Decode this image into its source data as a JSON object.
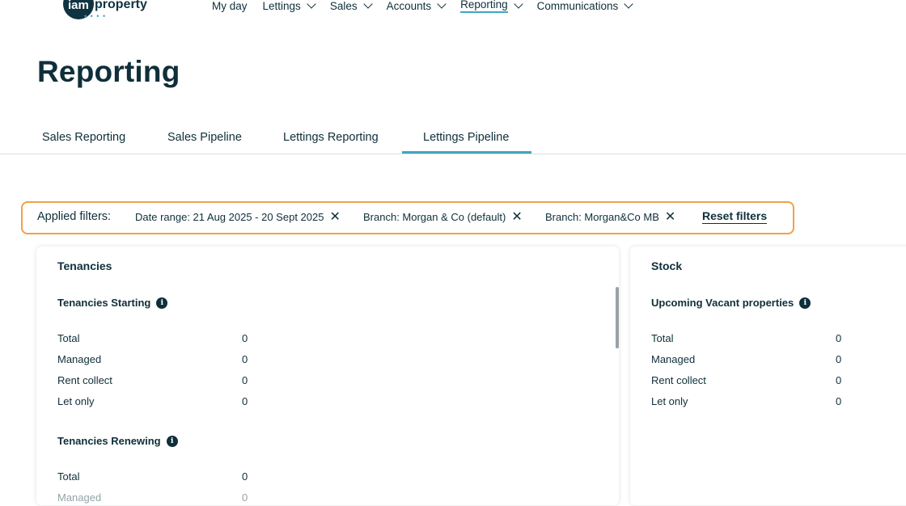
{
  "logo": {
    "iam": "iam",
    "property": "property",
    "dots": "• • • •"
  },
  "nav": [
    {
      "label": "My day",
      "has_dropdown": false,
      "active": false
    },
    {
      "label": "Lettings",
      "has_dropdown": true,
      "active": false
    },
    {
      "label": "Sales",
      "has_dropdown": true,
      "active": false
    },
    {
      "label": "Accounts",
      "has_dropdown": true,
      "active": false
    },
    {
      "label": "Reporting",
      "has_dropdown": true,
      "active": true
    },
    {
      "label": "Communications",
      "has_dropdown": true,
      "active": false
    }
  ],
  "page_title": "Reporting",
  "tabs": [
    {
      "label": "Sales Reporting",
      "active": false
    },
    {
      "label": "Sales Pipeline",
      "active": false
    },
    {
      "label": "Lettings Reporting",
      "active": false
    },
    {
      "label": "Lettings Pipeline",
      "active": true
    }
  ],
  "filters": {
    "label": "Applied filters:",
    "chips": [
      {
        "text": "Date range: 21 Aug 2025 - 20 Sept 2025",
        "remove_icon": "close-icon"
      },
      {
        "text": "Branch: Morgan & Co (default)",
        "remove_icon": "close-icon"
      },
      {
        "text": "Branch: Morgan&Co MB",
        "remove_icon": "close-icon"
      }
    ],
    "reset_label": "Reset filters",
    "highlight_color": "#f0a04b"
  },
  "tenancies": {
    "title": "Tenancies",
    "starting": {
      "title": "Tenancies Starting",
      "rows": [
        {
          "label": "Total",
          "value": "0"
        },
        {
          "label": "Managed",
          "value": "0"
        },
        {
          "label": "Rent collect",
          "value": "0"
        },
        {
          "label": "Let only",
          "value": "0"
        }
      ]
    },
    "renewing": {
      "title": "Tenancies Renewing",
      "rows": [
        {
          "label": "Total",
          "value": "0"
        },
        {
          "label": "Managed",
          "value": "0"
        }
      ]
    }
  },
  "stock": {
    "title": "Stock",
    "vacant": {
      "title": "Upcoming Vacant properties",
      "rows": [
        {
          "label": "Total",
          "value": "0"
        },
        {
          "label": "Managed",
          "value": "0"
        },
        {
          "label": "Rent collect",
          "value": "0"
        },
        {
          "label": "Let only",
          "value": "0"
        }
      ]
    }
  },
  "colors": {
    "accent": "#3fa7bf",
    "text": "#0f2f3a",
    "filter_border": "#f0a04b"
  }
}
